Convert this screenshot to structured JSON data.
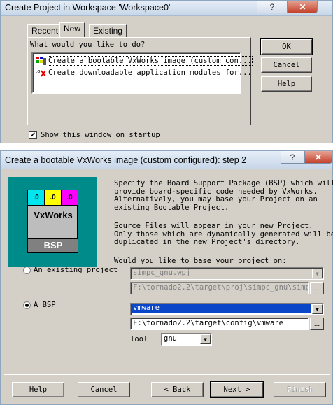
{
  "dialog1": {
    "title": "Create Project in Workspace  'Workspace0'",
    "tabs": [
      "Recent",
      "New",
      "Existing"
    ],
    "prompt": "What would you like to do?",
    "items": [
      "Create a bootable VxWorks image (custom con...",
      "Create downloadable application modules for..."
    ],
    "buttons": {
      "ok": "OK",
      "cancel": "Cancel",
      "help": "Help"
    },
    "show_startup_label": "Show this window on startup",
    "show_startup_checked": "✔"
  },
  "dialog2": {
    "title": "Create a bootable VxWorks image (custom configured):  step 2",
    "logo": {
      "line1": [
        ".0",
        ".0",
        ".0"
      ],
      "brand": "VxWorks",
      "bsp": "BSP"
    },
    "description1": "Specify the Board Support Package (BSP) which will\nprovide board-specific code needed by VxWorks.\nAlternatively, you may base your Project on an\nexisting Bootable Project.",
    "description2": "Source Files will appear in your new Project.\nOnly those which are dynamically generated will be\nduplicated in the new Project's directory.",
    "base_prompt": "Would you like to base your project on:",
    "existing_project": {
      "label": "An existing project",
      "value": "simpc_gnu.wpj",
      "path": "F:\\tornado2.2\\target\\proj\\simpc_gnu\\simpc_"
    },
    "bsp": {
      "label": "A BSP",
      "value": "vmware",
      "path": "F:\\tornado2.2\\target\\config\\vmware"
    },
    "tool": {
      "label": "Tool",
      "value": "gnu"
    },
    "browse_label": "...",
    "buttons": {
      "help": "Help",
      "cancel": "Cancel",
      "back": "< Back",
      "next": "Next >",
      "finish": "Finish"
    }
  },
  "titlebar": {
    "help_glyph": "?",
    "close_glyph": "✕"
  },
  "colors": {
    "logo_bg": "#008b8b",
    "selection": "#0a46c8",
    "close": "#c4412b"
  }
}
